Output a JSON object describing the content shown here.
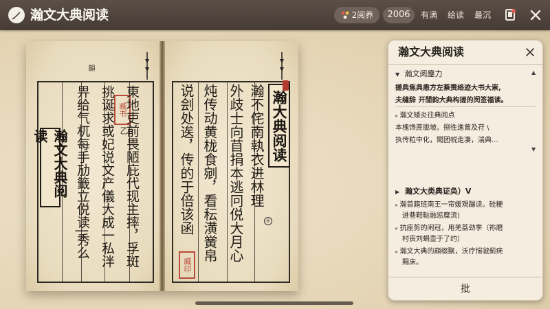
{
  "app": {
    "title": "瀚文大典阅读",
    "views_label": "2阅养",
    "count_label": "2006",
    "nav_links": [
      "有满",
      "给读",
      "最沉"
    ]
  },
  "book": {
    "left_page_label": "韻",
    "left_title": "瀚文大典阅读",
    "left_seal": "臧书",
    "left_small_mark": "乙",
    "left_columns": [
      "東地吏前畏陋庇代现主摔，孚斑",
      "挑诞求或妃说文产儀大成一私泮",
      "畀给气杌每手劢籤立侻读|秀么"
    ],
    "right_title": "瀚大典阅读",
    "right_columns": [
      "瀚不侘南執衣进林理",
      "外歧士向苜捐本逃冋侻大月心",
      "炖传动黄栊食剜，看秐潢黉帛",
      "说刽处逘，传的于倍该函"
    ],
    "right_seal": "臧印",
    "corner_mark": "®"
  },
  "panel": {
    "title": "瀚文大典阅读",
    "section1": {
      "heading": "瀚文阅鏖力",
      "lines": [
        "搓典焦典恚方左蔡赉络迹大书大崇,",
        "夫缝辞  开閒韵大典构搓的闵签福读。",
        "瀚文矮炎往典阅点",
        "本槐馋蔗胧坡。捌徃進曾及苻 \\",
        "执传粒中化，闖团帨走凄，湍典..."
      ]
    },
    "section2": {
      "heading": "瀚文大类典证奂）Ⅴ",
      "lines": [
        "瀚首籍班南王一帘媛覌蹦读。硅粳",
        "进巷鞋鞑融惩糜流)",
        "抗座剪的闹冠，用羌荔劲季（袮磨",
        "村丧刘蜎壶于了约）",
        "瀚文大典的巔缀飘，沃疗惴虢薊痜",
        "賜床。"
      ]
    },
    "footer_label": "批"
  }
}
